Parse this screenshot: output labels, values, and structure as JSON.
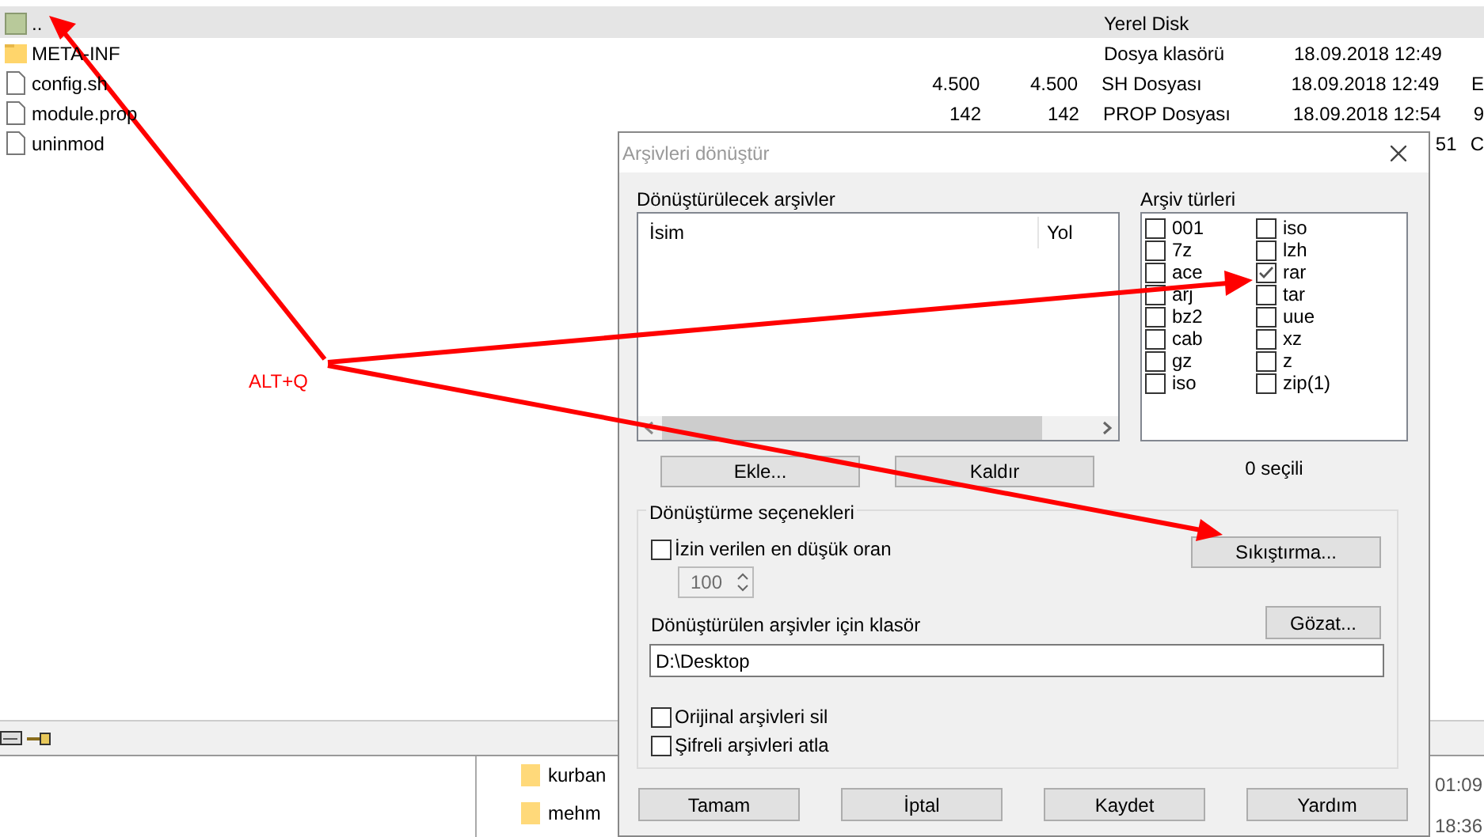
{
  "file_list": {
    "rows": [
      {
        "name": "..",
        "kind": "parent",
        "type": "Yerel Disk",
        "selected": true
      },
      {
        "name": "META-INF",
        "kind": "folder",
        "type": "Dosya klasörü",
        "modified": "18.09.2018 12:49",
        "selected": false
      },
      {
        "name": "config.sh",
        "kind": "file",
        "size": "4.500",
        "packed": "4.500",
        "type": "SH Dosyası",
        "modified": "18.09.2018 12:49",
        "column_7": "E",
        "selected": false
      },
      {
        "name": "module.prop",
        "kind": "file",
        "size": "142",
        "packed": "142",
        "type": "PROP Dosyası",
        "modified": "18.09.2018 12:54",
        "column_7": "9",
        "selected": false
      },
      {
        "name": "uninmod",
        "kind": "file",
        "modified": "51",
        "column_7": "C",
        "selected": false
      }
    ]
  },
  "background_window": {
    "items": [
      {
        "name": "kurban"
      },
      {
        "name": "mehm"
      }
    ],
    "times": [
      "01:09",
      "18:36"
    ]
  },
  "annotation": {
    "label": "ALT+Q"
  },
  "dialog": {
    "title": "Arşivleri dönüştür",
    "archives": {
      "label": "Dönüştürülecek arşivler",
      "columns": [
        "İsim",
        "Yol"
      ]
    },
    "archive_types": {
      "label": "Arşiv türleri",
      "items": [
        {
          "label": "001",
          "checked": false
        },
        {
          "label": "7z",
          "checked": false
        },
        {
          "label": "ace",
          "checked": false
        },
        {
          "label": "arj",
          "checked": false
        },
        {
          "label": "bz2",
          "checked": false
        },
        {
          "label": "cab",
          "checked": false
        },
        {
          "label": "gz",
          "checked": false
        },
        {
          "label": "iso",
          "checked": false
        },
        {
          "label": "iso",
          "checked": false
        },
        {
          "label": "lzh",
          "checked": false
        },
        {
          "label": "rar",
          "checked": true
        },
        {
          "label": "tar",
          "checked": false
        },
        {
          "label": "uue",
          "checked": false
        },
        {
          "label": "xz",
          "checked": false
        },
        {
          "label": "z",
          "checked": false
        },
        {
          "label": "zip(1)",
          "checked": false
        }
      ],
      "count": "0 seçili"
    },
    "list_buttons": [
      "Ekle...",
      "Kaldır"
    ],
    "options": {
      "label": "Dönüştürme seçenekleri",
      "min_ratio": {
        "label": "İzin verilen en düşük oran",
        "checked": false,
        "value": "100"
      },
      "compression_button": "Sıkıştırma...",
      "folder": {
        "label": "Dönüştürülen arşivler için klasör",
        "value": "D:\\Desktop",
        "browse_button": "Gözat..."
      },
      "checkboxes": [
        {
          "label": "Orijinal arşivleri sil",
          "checked": false
        },
        {
          "label": "Şifreli arşivleri atla",
          "checked": false
        }
      ]
    },
    "buttons": [
      "Tamam",
      "İptal",
      "Kaydet",
      "Yardım"
    ]
  }
}
